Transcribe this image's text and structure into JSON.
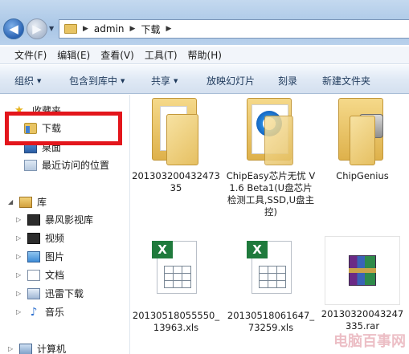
{
  "address": {
    "path": [
      "admin",
      "下载"
    ]
  },
  "menu": [
    "文件(F)",
    "编辑(E)",
    "查看(V)",
    "工具(T)",
    "帮助(H)"
  ],
  "toolbar": {
    "organize": "组织",
    "include_library": "包含到库中",
    "share": "共享",
    "slideshow": "放映幻灯片",
    "burn": "刻录",
    "new_folder": "新建文件夹"
  },
  "sidebar": {
    "favorites_header": "收藏夹",
    "favorites": [
      "下载",
      "桌面",
      "最近访问的位置"
    ],
    "library_header": "库",
    "libraries": [
      "暴风影视库",
      "视频",
      "图片",
      "文档",
      "迅雷下载",
      "音乐"
    ],
    "computer": "计算机"
  },
  "files": [
    {
      "name": "20130320043247335",
      "kind": "folder"
    },
    {
      "name": "ChipEasy芯片无忧 V1.6 Beta1(U盘芯片检测工具,SSD,U盘主控)",
      "kind": "folder-ie"
    },
    {
      "name": "ChipGenius",
      "kind": "folder-usb"
    },
    {
      "name": "20130518055550_13963.xls",
      "kind": "excel"
    },
    {
      "name": "20130518061647_73259.xls",
      "kind": "excel"
    },
    {
      "name": "20130320043247335.rar",
      "kind": "rar"
    }
  ],
  "watermark": "电脑百事网"
}
